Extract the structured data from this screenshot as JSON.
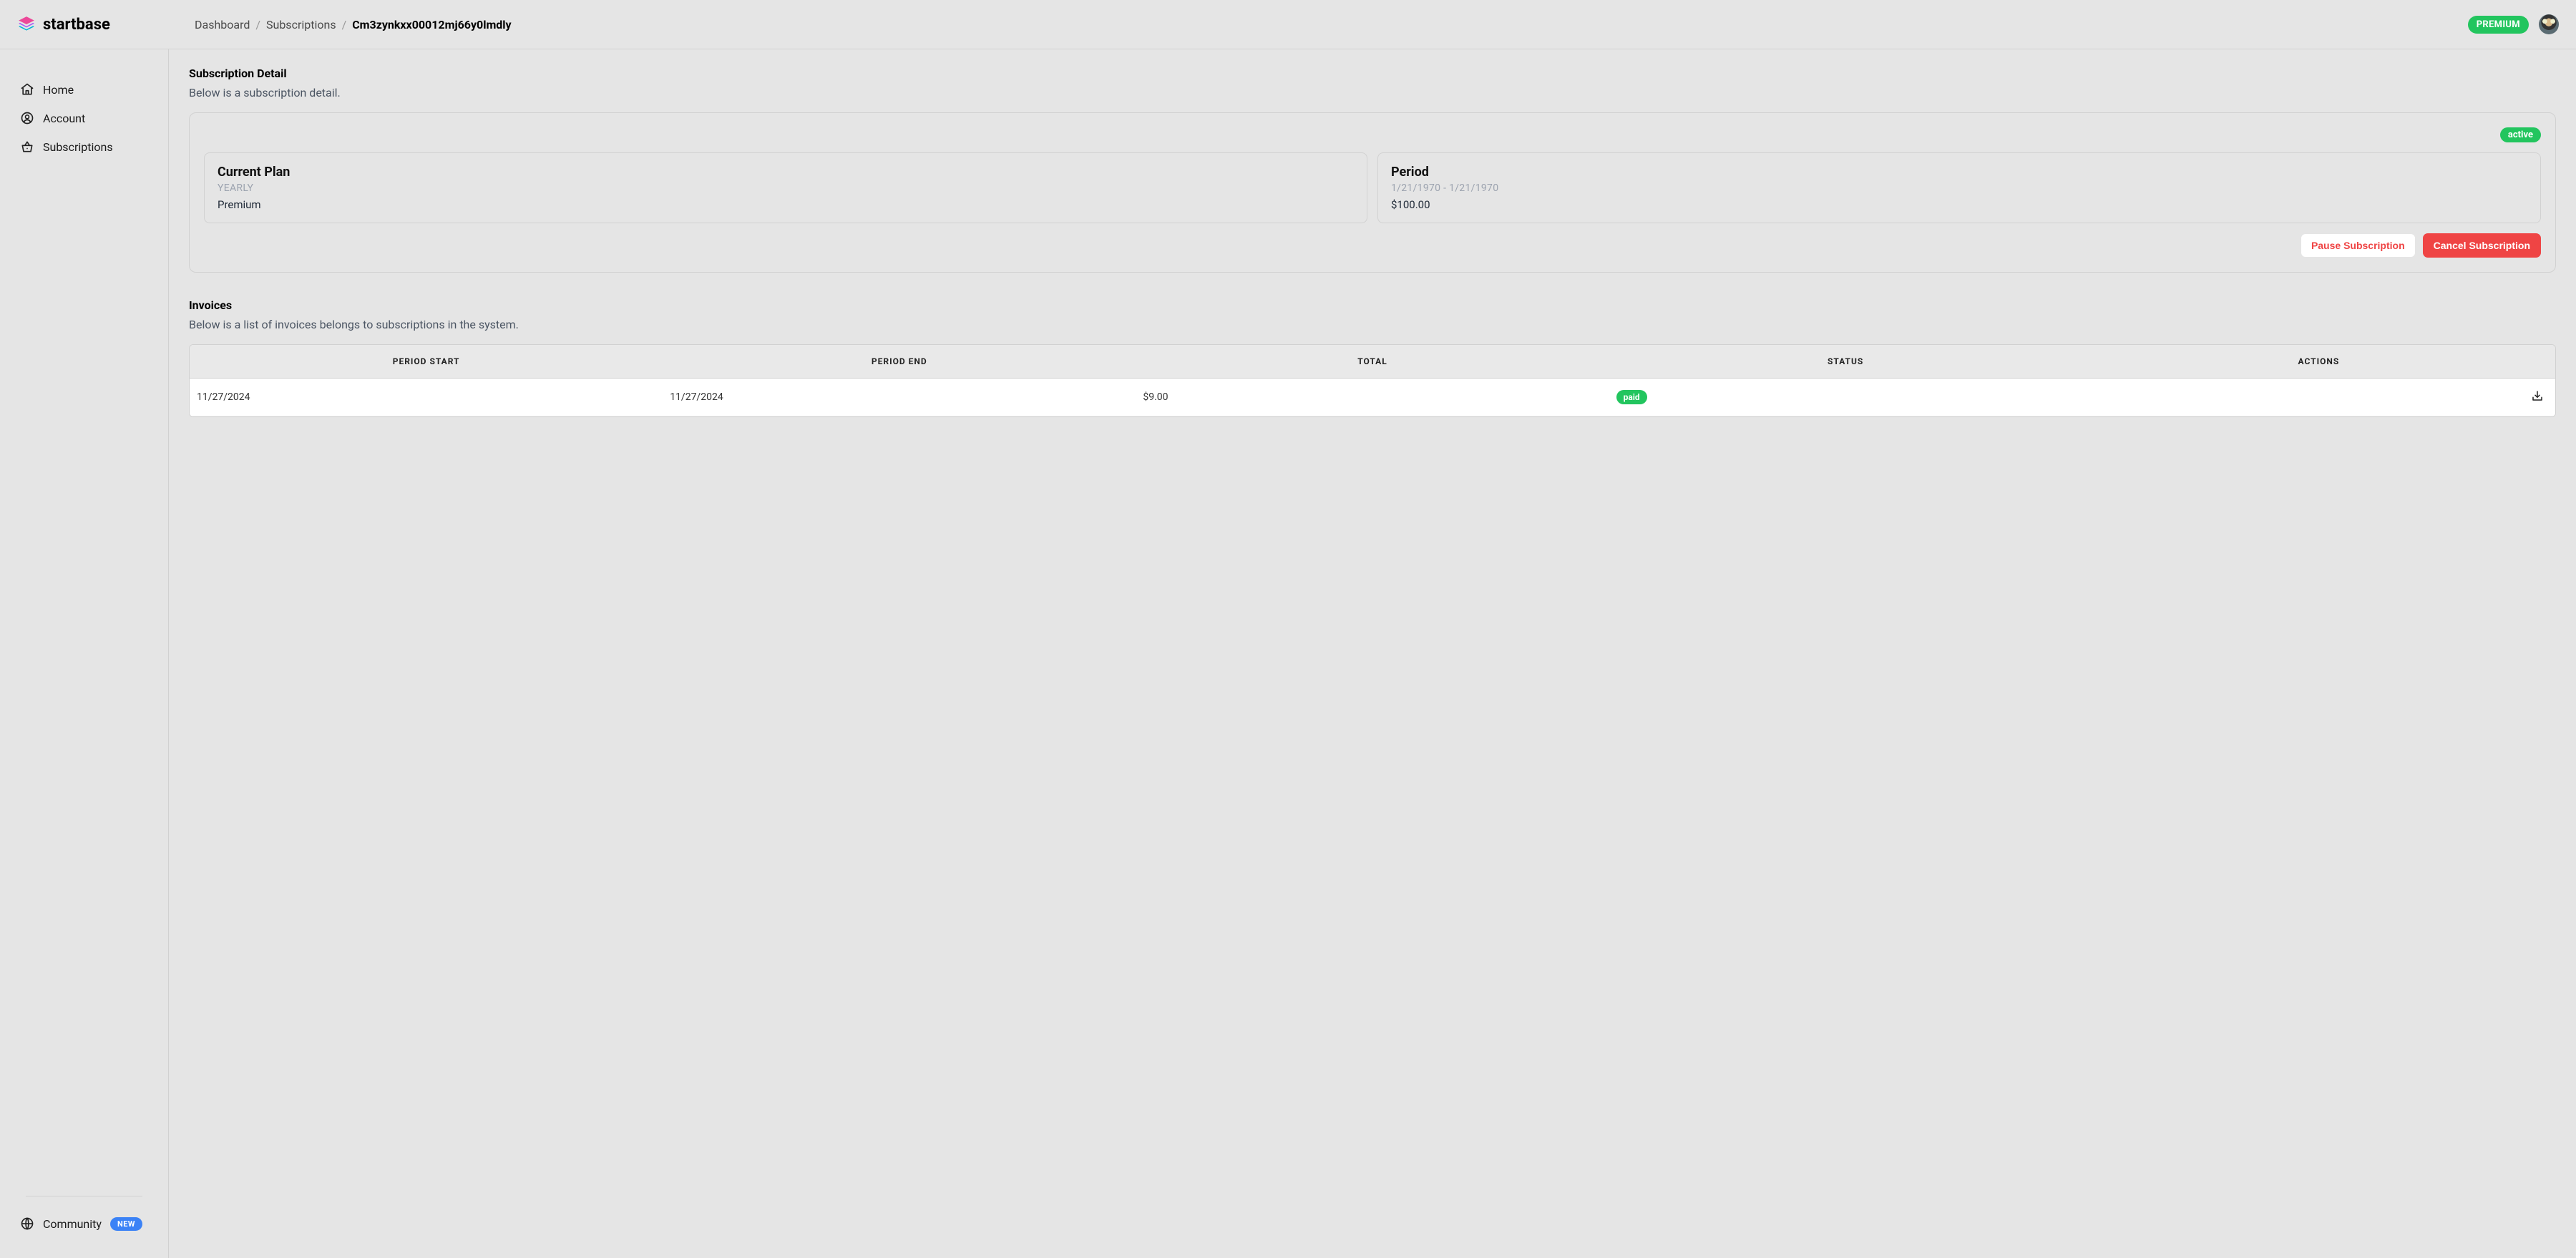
{
  "brand": {
    "name": "startbase"
  },
  "breadcrumb": {
    "items": [
      {
        "label": "Dashboard"
      },
      {
        "label": "Subscriptions"
      }
    ],
    "current": "Cm3zynkxx00012mj66y0lmdly",
    "sep": "/"
  },
  "header": {
    "premium_label": "PREMIUM"
  },
  "sidebar": {
    "items": [
      {
        "label": "Home",
        "icon": "home"
      },
      {
        "label": "Account",
        "icon": "user-circle"
      },
      {
        "label": "Subscriptions",
        "icon": "basket"
      }
    ],
    "footer": {
      "community_label": "Community",
      "new_badge": "NEW",
      "icon": "globe"
    }
  },
  "subscription": {
    "title": "Subscription Detail",
    "subtitle": "Below is a subscription detail.",
    "status": "active",
    "current_plan": {
      "heading": "Current Plan",
      "interval": "YEARLY",
      "name": "Premium"
    },
    "period": {
      "heading": "Period",
      "range": "1/21/1970 - 1/21/1970",
      "amount": "$100.00"
    },
    "actions": {
      "pause": "Pause Subscription",
      "cancel": "Cancel Subscription"
    }
  },
  "invoices": {
    "title": "Invoices",
    "subtitle": "Below is a list of invoices belongs to subscriptions in the system.",
    "columns": {
      "period_start": "PERIOD START",
      "period_end": "PERIOD END",
      "total": "TOTAL",
      "status": "STATUS",
      "actions": "ACTIONS"
    },
    "rows": [
      {
        "period_start": "11/27/2024",
        "period_end": "11/27/2024",
        "total": "$9.00",
        "status": "paid"
      }
    ]
  }
}
